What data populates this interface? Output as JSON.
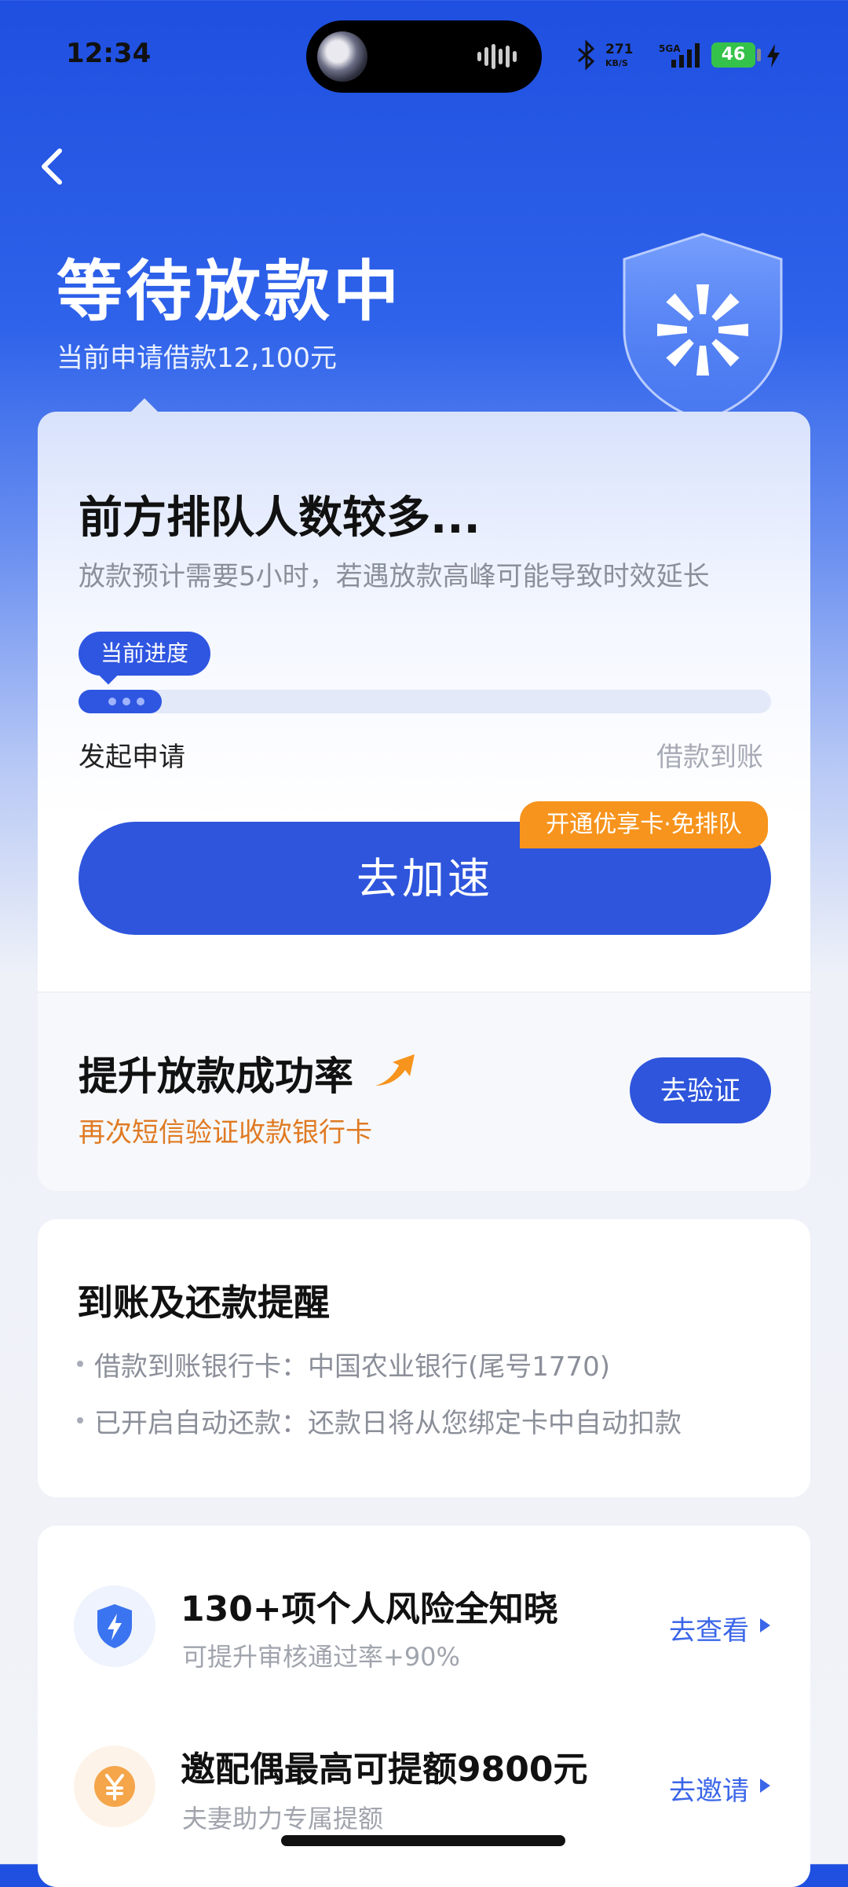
{
  "status_bar": {
    "time": "12:34",
    "network_speed": "271",
    "network_unit": "KB/S",
    "signal_label": "5GA",
    "battery": "46",
    "colors": {
      "battery": "#35c24a"
    }
  },
  "header": {
    "title": "等待放款中",
    "subtitle": "当前申请借款12,100元"
  },
  "queue": {
    "title": "前方排队人数较多...",
    "description": "放款预计需要5小时，若遇放款高峰可能导致时效延长",
    "progress_tag": "当前进度",
    "progress_fraction": 0.12,
    "start_label": "发起申请",
    "end_label": "借款到账",
    "accelerate_button": "去加速",
    "vip_badge": "开通优享卡·免排队"
  },
  "boost": {
    "title": "提升放款成功率",
    "subtitle": "再次短信验证收款银行卡",
    "verify_button": "去验证"
  },
  "reminder": {
    "title": "到账及还款提醒",
    "items": [
      "借款到账银行卡：中国农业银行(尾号1770)",
      "已开启自动还款：还款日将从您绑定卡中自动扣款"
    ]
  },
  "promos": [
    {
      "title": "130+项个人风险全知晓",
      "subtitle": "可提升审核通过率+90%",
      "link": "去查看",
      "icon": "shield-bolt-icon"
    },
    {
      "title": "邀配偶最高可提额9800元",
      "subtitle": "夫妻助力专属提额",
      "link": "去邀请",
      "icon": "yuan-coin-icon"
    }
  ],
  "colors": {
    "primary": "#2e55dc",
    "accent_orange": "#f7941d",
    "link_blue": "#3b66e8"
  }
}
